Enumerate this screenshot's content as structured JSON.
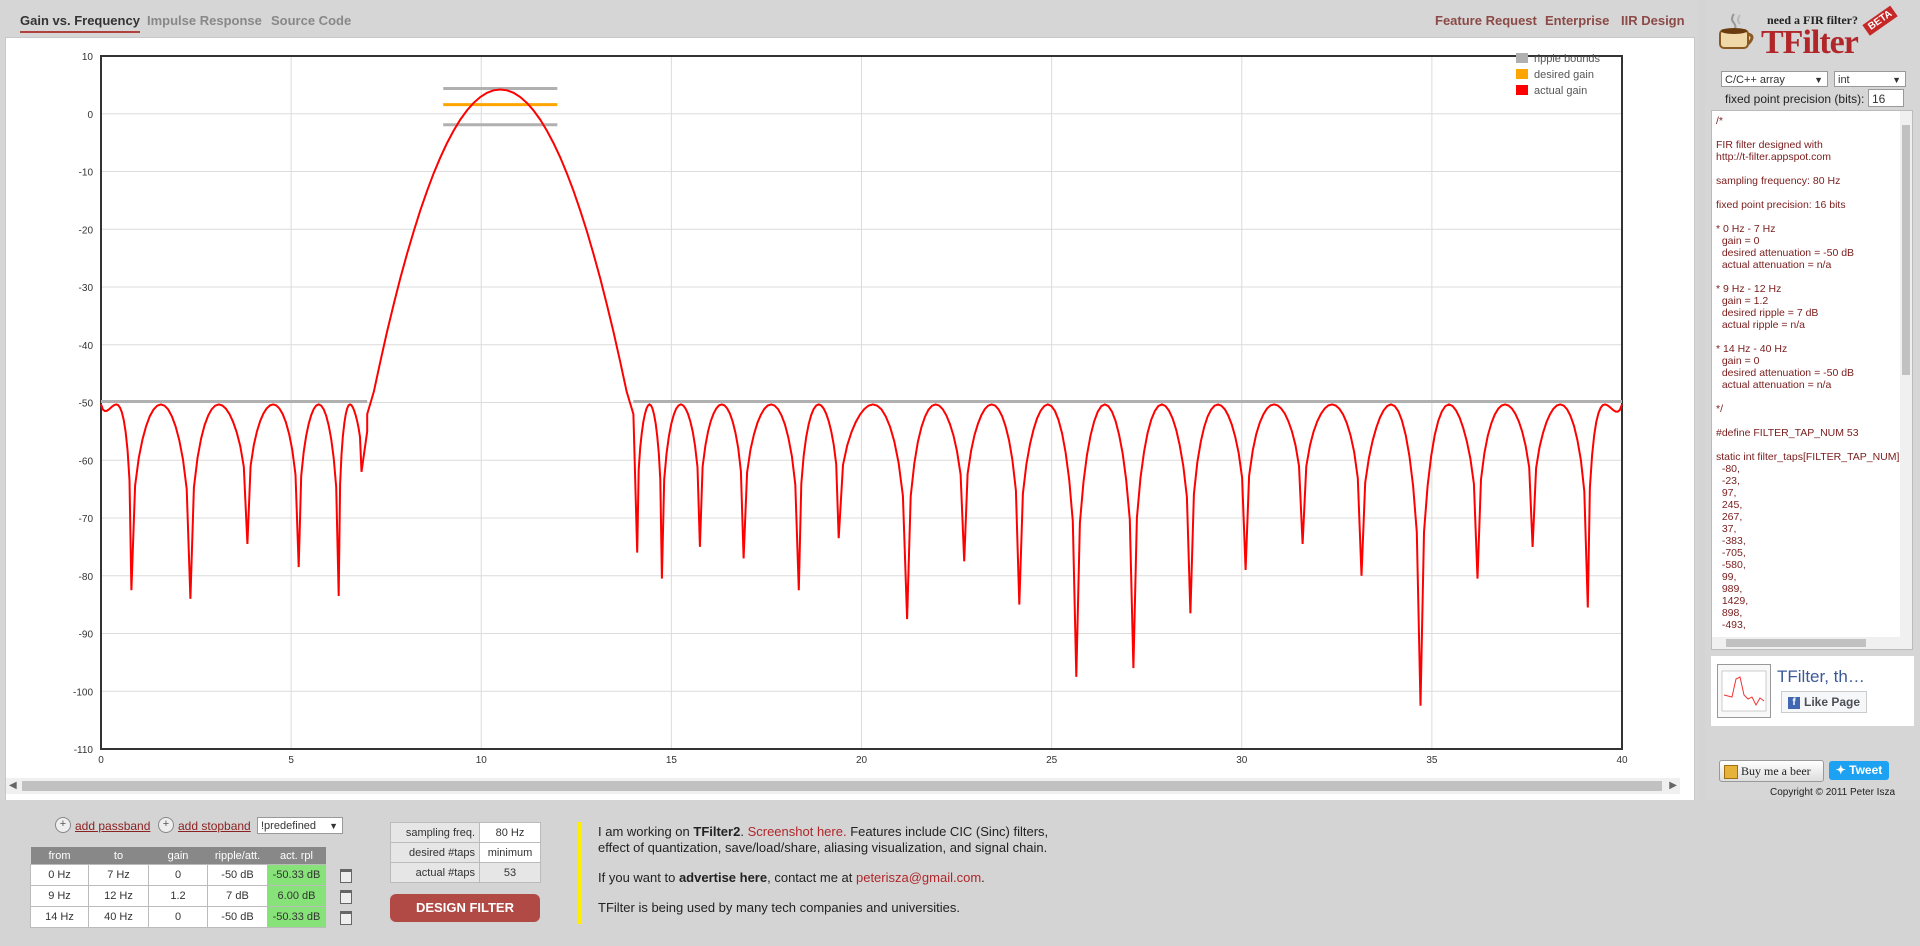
{
  "tabs": [
    {
      "label": "Gain vs. Frequency",
      "active": true
    },
    {
      "label": "Impulse Response",
      "active": false
    },
    {
      "label": "Source Code",
      "active": false
    }
  ],
  "top_links": [
    "Feature Request",
    "Enterprise",
    "IIR Design"
  ],
  "chart_data": {
    "type": "line",
    "title": "",
    "xlabel": "",
    "ylabel": "",
    "xlim": [
      0,
      40
    ],
    "ylim": [
      -110,
      10
    ],
    "x_ticks": [
      0,
      5,
      10,
      15,
      20,
      25,
      30,
      35,
      40
    ],
    "y_ticks": [
      10,
      0,
      -10,
      -20,
      -30,
      -40,
      -50,
      -60,
      -70,
      -80,
      -90,
      -100,
      -110
    ],
    "grid": true,
    "legend_position": "top-right",
    "legend": [
      {
        "label": "ripple bounds",
        "color": "#b0b0b0"
      },
      {
        "label": "desired gain",
        "color": "#ffa500"
      },
      {
        "label": "actual gain",
        "color": "#ff0000"
      }
    ],
    "ripple_bounds": [
      {
        "x": [
          0,
          7
        ],
        "y": [
          -50,
          -50
        ]
      },
      {
        "x": [
          9,
          12
        ],
        "y": [
          4.2,
          -1.9
        ]
      },
      {
        "x": [
          14,
          40
        ],
        "y": [
          -50,
          -50
        ]
      }
    ],
    "desired_gain": [
      {
        "x": [
          9,
          12
        ],
        "y": [
          1.58,
          1.58
        ]
      }
    ],
    "actual_gain": {
      "passband_peak": {
        "x": 10.5,
        "y": 4.2
      },
      "edges": [
        {
          "x": 7.0,
          "y": -57
        },
        {
          "x": 14.0,
          "y": -52
        }
      ],
      "nulls": [
        {
          "x": 0.8,
          "y": -82.5
        },
        {
          "x": 2.35,
          "y": -84
        },
        {
          "x": 3.85,
          "y": -74.5
        },
        {
          "x": 5.2,
          "y": -78.5
        },
        {
          "x": 6.25,
          "y": -83.5
        },
        {
          "x": 6.85,
          "y": -62
        },
        {
          "x": 14.1,
          "y": -76
        },
        {
          "x": 14.75,
          "y": -80.5
        },
        {
          "x": 15.75,
          "y": -75
        },
        {
          "x": 16.9,
          "y": -77
        },
        {
          "x": 18.35,
          "y": -82.5
        },
        {
          "x": 19.4,
          "y": -73.5
        },
        {
          "x": 21.2,
          "y": -87.5
        },
        {
          "x": 22.7,
          "y": -77.5
        },
        {
          "x": 24.15,
          "y": -85
        },
        {
          "x": 25.65,
          "y": -97.5
        },
        {
          "x": 27.15,
          "y": -96
        },
        {
          "x": 28.65,
          "y": -86.5
        },
        {
          "x": 30.1,
          "y": -79
        },
        {
          "x": 31.6,
          "y": -74.5
        },
        {
          "x": 33.15,
          "y": -80
        },
        {
          "x": 34.7,
          "y": -102.5
        },
        {
          "x": 36.2,
          "y": -80.5
        },
        {
          "x": 37.65,
          "y": -75
        },
        {
          "x": 39.1,
          "y": -85.5
        }
      ],
      "lobe_peak_db": -50.33
    }
  },
  "sidebar": {
    "logo_need": "need a FIR filter?",
    "logo_title": "TFilter",
    "logo_beta": "BETA",
    "lang_select": "C/C++ array",
    "type_select": "int",
    "fpp_label": "fixed point precision (bits):",
    "fpp_value": "16",
    "code_text": "/*\n\nFIR filter designed with\nhttp://t-filter.appspot.com\n\nsampling frequency: 80 Hz\n\nfixed point precision: 16 bits\n\n* 0 Hz - 7 Hz\n  gain = 0\n  desired attenuation = -50 dB\n  actual attenuation = n/a\n\n* 9 Hz - 12 Hz\n  gain = 1.2\n  desired ripple = 7 dB\n  actual ripple = n/a\n\n* 14 Hz - 40 Hz\n  gain = 0\n  desired attenuation = -50 dB\n  actual attenuation = n/a\n\n*/\n\n#define FILTER_TAP_NUM 53\n\nstatic int filter_taps[FILTER_TAP_NUM] = {\n  -80,\n  -23,\n  97,\n  245,\n  267,\n  37,\n  -383,\n  -705,\n  -580,\n  99,\n  989,\n  1429,\n  898,\n  -493,",
    "fb_name": "TFilter, th…",
    "fb_like": "Like Page",
    "beer": "Buy me a beer",
    "tweet": "Tweet",
    "copyright": "Copyright © 2011 Peter Isza"
  },
  "bottom": {
    "add_passband": "add passband",
    "add_stopband": "add stopband",
    "predefined": "!predefined",
    "band_headers": [
      "from",
      "to",
      "gain",
      "ripple/att.",
      "act. rpl"
    ],
    "bands": [
      [
        "0 Hz",
        "7 Hz",
        "0",
        "-50 dB",
        "-50.33 dB"
      ],
      [
        "9 Hz",
        "12 Hz",
        "1.2",
        "7 dB",
        "6.00 dB"
      ],
      [
        "14 Hz",
        "40 Hz",
        "0",
        "-50 dB",
        "-50.33 dB"
      ]
    ],
    "params": [
      {
        "label": "sampling freq.",
        "value": "80 Hz"
      },
      {
        "label": "desired #taps",
        "value": "minimum"
      },
      {
        "label": "actual #taps",
        "value": "53"
      }
    ],
    "design_button": "DESIGN FILTER",
    "msg1_a": "I am working on ",
    "msg1_b": "TFilter2",
    "msg1_c": ". ",
    "msg1_link": "Screenshot here.",
    "msg1_d": " Features include CIC (Sinc) filters,",
    "msg1_e": "effect of quantization, save/load/share, aliasing visualization, and signal chain.",
    "msg2_a": "If you want to ",
    "msg2_b": "advertise here",
    "msg2_c": ", contact me at ",
    "msg2_email": "peterisza@gmail.com",
    "msg2_d": ".",
    "msg3": "TFilter is being used by many tech companies and universities."
  }
}
